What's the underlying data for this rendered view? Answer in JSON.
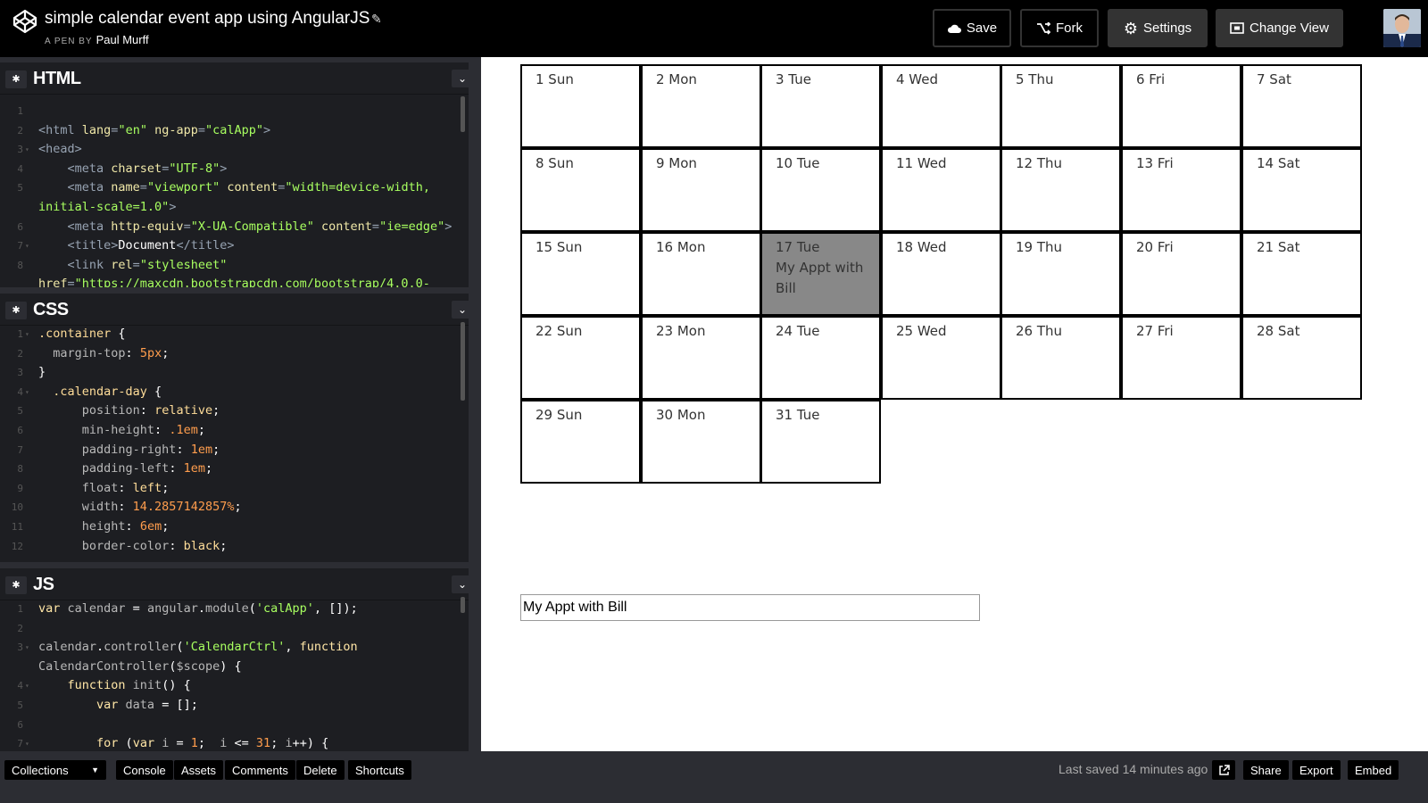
{
  "header": {
    "pen_title": "simple calendar event app using AngularJS",
    "byline_prefix": "A PEN BY",
    "author": "Paul Murff",
    "buttons": {
      "save": "Save",
      "fork": "Fork",
      "settings": "Settings",
      "change_view": "Change View"
    }
  },
  "editors": {
    "html": {
      "title": "HTML",
      "lines": [
        {
          "n": "1",
          "segs": []
        },
        {
          "n": "2",
          "segs": [
            [
              "c-tag",
              "<html "
            ],
            [
              "c-attr",
              "lang"
            ],
            [
              "c-tag",
              "="
            ],
            [
              "c-str",
              "\"en\""
            ],
            [
              "c-tag",
              " "
            ],
            [
              "c-attr",
              "ng-app"
            ],
            [
              "c-tag",
              "="
            ],
            [
              "c-str",
              "\"calApp\""
            ],
            [
              "c-tag",
              ">"
            ]
          ]
        },
        {
          "n": "3",
          "arrow": true,
          "segs": [
            [
              "c-tag",
              "<head>"
            ]
          ]
        },
        {
          "n": "4",
          "segs": [
            [
              "c-tag",
              "    <meta "
            ],
            [
              "c-attr",
              "charset"
            ],
            [
              "c-tag",
              "="
            ],
            [
              "c-str",
              "\"UTF-8\""
            ],
            [
              "c-tag",
              ">"
            ]
          ]
        },
        {
          "n": "5",
          "segs": [
            [
              "c-tag",
              "    <meta "
            ],
            [
              "c-attr",
              "name"
            ],
            [
              "c-tag",
              "="
            ],
            [
              "c-str",
              "\"viewport\""
            ],
            [
              "c-tag",
              " "
            ],
            [
              "c-attr",
              "content"
            ],
            [
              "c-tag",
              "="
            ],
            [
              "c-str",
              "\"width=device-width,"
            ]
          ]
        },
        {
          "n": "",
          "segs": [
            [
              "c-str",
              "initial-scale=1.0\""
            ],
            [
              "c-tag",
              ">"
            ]
          ]
        },
        {
          "n": "6",
          "segs": [
            [
              "c-tag",
              "    <meta "
            ],
            [
              "c-attr",
              "http-equiv"
            ],
            [
              "c-tag",
              "="
            ],
            [
              "c-str",
              "\"X-UA-Compatible\""
            ],
            [
              "c-tag",
              " "
            ],
            [
              "c-attr",
              "content"
            ],
            [
              "c-tag",
              "="
            ],
            [
              "c-str",
              "\"ie=edge\""
            ],
            [
              "c-tag",
              ">"
            ]
          ]
        },
        {
          "n": "7",
          "arrow": true,
          "segs": [
            [
              "c-tag",
              "    <title>"
            ],
            [
              "c-white",
              "Document"
            ],
            [
              "c-tag",
              "</title>"
            ]
          ]
        },
        {
          "n": "8",
          "segs": [
            [
              "c-tag",
              "    <link "
            ],
            [
              "c-attr",
              "rel"
            ],
            [
              "c-tag",
              "="
            ],
            [
              "c-str",
              "\"stylesheet\""
            ]
          ]
        },
        {
          "n": "",
          "segs": [
            [
              "c-attr",
              "href"
            ],
            [
              "c-tag",
              "="
            ],
            [
              "c-str",
              "\"https://maxcdn.bootstrapcdn.com/bootstrap/4.0.0-"
            ]
          ]
        }
      ]
    },
    "css": {
      "title": "CSS",
      "lines": [
        {
          "n": "1",
          "arrow": true,
          "segs": [
            [
              "c-key",
              ".container"
            ],
            [
              "c-white",
              " {"
            ]
          ]
        },
        {
          "n": "2",
          "segs": [
            [
              "c-prop",
              "  margin-top"
            ],
            [
              "c-white",
              ": "
            ],
            [
              "c-num",
              "5px"
            ],
            [
              "c-white",
              ";"
            ]
          ]
        },
        {
          "n": "3",
          "segs": [
            [
              "c-white",
              "}"
            ]
          ]
        },
        {
          "n": "4",
          "arrow": true,
          "segs": [
            [
              "c-key",
              "  .calendar-day"
            ],
            [
              "c-white",
              " {"
            ]
          ]
        },
        {
          "n": "5",
          "segs": [
            [
              "c-prop",
              "      position"
            ],
            [
              "c-white",
              ": "
            ],
            [
              "c-key",
              "relative"
            ],
            [
              "c-white",
              ";"
            ]
          ]
        },
        {
          "n": "6",
          "segs": [
            [
              "c-prop",
              "      min-height"
            ],
            [
              "c-white",
              ": "
            ],
            [
              "c-num",
              ".1em"
            ],
            [
              "c-white",
              ";"
            ]
          ]
        },
        {
          "n": "7",
          "segs": [
            [
              "c-prop",
              "      padding-right"
            ],
            [
              "c-white",
              ": "
            ],
            [
              "c-num",
              "1em"
            ],
            [
              "c-white",
              ";"
            ]
          ]
        },
        {
          "n": "8",
          "segs": [
            [
              "c-prop",
              "      padding-left"
            ],
            [
              "c-white",
              ": "
            ],
            [
              "c-num",
              "1em"
            ],
            [
              "c-white",
              ";"
            ]
          ]
        },
        {
          "n": "9",
          "segs": [
            [
              "c-prop",
              "      float"
            ],
            [
              "c-white",
              ": "
            ],
            [
              "c-key",
              "left"
            ],
            [
              "c-white",
              ";"
            ]
          ]
        },
        {
          "n": "10",
          "segs": [
            [
              "c-prop",
              "      width"
            ],
            [
              "c-white",
              ": "
            ],
            [
              "c-num",
              "14.2857142857%"
            ],
            [
              "c-white",
              ";"
            ]
          ]
        },
        {
          "n": "11",
          "segs": [
            [
              "c-prop",
              "      height"
            ],
            [
              "c-white",
              ": "
            ],
            [
              "c-num",
              "6em"
            ],
            [
              "c-white",
              ";"
            ]
          ]
        },
        {
          "n": "12",
          "segs": [
            [
              "c-prop",
              "      border-color"
            ],
            [
              "c-white",
              ": "
            ],
            [
              "c-key",
              "black"
            ],
            [
              "c-white",
              ";"
            ]
          ]
        }
      ]
    },
    "js": {
      "title": "JS",
      "lines": [
        {
          "n": "1",
          "segs": [
            [
              "c-fn",
              "var "
            ],
            [
              "c-prop",
              "calendar "
            ],
            [
              "c-white",
              "= "
            ],
            [
              "c-prop",
              "angular"
            ],
            [
              "c-white",
              "."
            ],
            [
              "c-prop",
              "module"
            ],
            [
              "c-white",
              "("
            ],
            [
              "c-str",
              "'calApp'"
            ],
            [
              "c-white",
              ", []);"
            ]
          ]
        },
        {
          "n": "2",
          "segs": []
        },
        {
          "n": "3",
          "arrow": true,
          "segs": [
            [
              "c-prop",
              "calendar"
            ],
            [
              "c-white",
              "."
            ],
            [
              "c-prop",
              "controller"
            ],
            [
              "c-white",
              "("
            ],
            [
              "c-str",
              "'CalendarCtrl'"
            ],
            [
              "c-white",
              ", "
            ],
            [
              "c-fn",
              "function"
            ]
          ]
        },
        {
          "n": "",
          "segs": [
            [
              "c-prop",
              "CalendarController"
            ],
            [
              "c-white",
              "("
            ],
            [
              "c-prop",
              "$scope"
            ],
            [
              "c-white",
              ") {"
            ]
          ]
        },
        {
          "n": "4",
          "arrow": true,
          "segs": [
            [
              "c-fn",
              "    function "
            ],
            [
              "c-prop",
              "init"
            ],
            [
              "c-white",
              "() {"
            ]
          ]
        },
        {
          "n": "5",
          "segs": [
            [
              "c-fn",
              "        var "
            ],
            [
              "c-prop",
              "data "
            ],
            [
              "c-white",
              "= [];"
            ]
          ]
        },
        {
          "n": "6",
          "segs": []
        },
        {
          "n": "7",
          "arrow": true,
          "segs": [
            [
              "c-fn",
              "        for "
            ],
            [
              "c-white",
              "("
            ],
            [
              "c-fn",
              "var "
            ],
            [
              "c-prop",
              "i "
            ],
            [
              "c-white",
              "= "
            ],
            [
              "c-num",
              "1"
            ],
            [
              "c-white",
              ";  "
            ],
            [
              "c-prop",
              "i "
            ],
            [
              "c-white",
              "<= "
            ],
            [
              "c-num",
              "31"
            ],
            [
              "c-white",
              "; "
            ],
            [
              "c-prop",
              "i"
            ],
            [
              "c-white",
              "++) {"
            ]
          ]
        }
      ]
    }
  },
  "calendar": {
    "days": [
      {
        "label": "1 Sun"
      },
      {
        "label": "2 Mon"
      },
      {
        "label": "3 Tue"
      },
      {
        "label": "4 Wed"
      },
      {
        "label": "5 Thu"
      },
      {
        "label": "6 Fri"
      },
      {
        "label": "7 Sat"
      },
      {
        "label": "8 Sun"
      },
      {
        "label": "9 Mon"
      },
      {
        "label": "10 Tue"
      },
      {
        "label": "11 Wed"
      },
      {
        "label": "12 Thu"
      },
      {
        "label": "13 Fri"
      },
      {
        "label": "14 Sat"
      },
      {
        "label": "15 Sun"
      },
      {
        "label": "16 Mon"
      },
      {
        "label": "17 Tue",
        "event": "My Appt with Bill",
        "selected": true
      },
      {
        "label": "18 Wed"
      },
      {
        "label": "19 Thu"
      },
      {
        "label": "20 Fri"
      },
      {
        "label": "21 Sat"
      },
      {
        "label": "22 Sun"
      },
      {
        "label": "23 Mon"
      },
      {
        "label": "24 Tue"
      },
      {
        "label": "25 Wed"
      },
      {
        "label": "26 Thu"
      },
      {
        "label": "27 Fri"
      },
      {
        "label": "28 Sat"
      },
      {
        "label": "29 Sun"
      },
      {
        "label": "30 Mon"
      },
      {
        "label": "31 Tue"
      }
    ],
    "event_input_value": "My Appt with Bill"
  },
  "footer": {
    "collections": "Collections",
    "console": "Console",
    "assets": "Assets",
    "comments": "Comments",
    "delete": "Delete",
    "shortcuts": "Shortcuts",
    "last_saved": "Last saved 14 minutes ago",
    "share": "Share",
    "export": "Export",
    "embed": "Embed"
  },
  "colors": {
    "selected_day": "#888888",
    "editor_bg": "#1d1e22",
    "chrome_bg": "#2c2d33"
  }
}
